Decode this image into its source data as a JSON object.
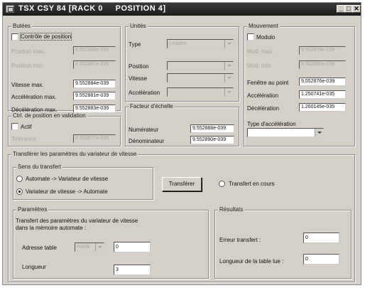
{
  "window": {
    "title": "TSX CSY 84 [RACK 0     POSITION 4]",
    "minimize": "_",
    "maximize": "□",
    "close": "✕"
  },
  "butees": {
    "title": "Butées",
    "controle_label": "Contrôle de position",
    "pos_max_label": "Position max.",
    "pos_max_value": "9.552888e-039",
    "pos_min_label": "Position min.",
    "pos_min_value": "9.552887e-039",
    "vitesse_label": "Vitesse max.",
    "vitesse_value": "9.552884e-039",
    "accel_label": "Accélération max.",
    "accel_value": "9.552881e-039",
    "decel_label": "Décélération max.",
    "decel_value": "9.552883e-039"
  },
  "ctrl_validation": {
    "title": "Ctrl. de position en validation",
    "actif_label": "Actif",
    "tolerance_label": "Tolérance",
    "tolerance_value": "9.552877e-039"
  },
  "unites": {
    "title": "Unités",
    "type_label": "Type",
    "type_value": "Linéaire",
    "position_label": "Position",
    "vitesse_label": "Vitesse",
    "acceleration_label": "Accélération"
  },
  "facteur": {
    "title": "Facteur d'échelle",
    "numerateur_label": "Numérateur",
    "numerateur_value": "9.552888e-039",
    "denominateur_label": "Dénominateur",
    "denominateur_value": "9.552890e-039"
  },
  "mouvement": {
    "title": "Mouvement",
    "modulo_label": "Modulo",
    "mod_max_label": "Mod. max.",
    "mod_max_value": "9.552879e-039",
    "mod_min_label": "Mod. min.",
    "mod_min_value": "9.552880e-039",
    "fenetre_label": "Fenêtre au point",
    "fenetre_value": "9.552876e-039",
    "acceleration_label": "Accélération",
    "acceleration_value": "1.250741e-035",
    "deceleration_label": "Décélération",
    "deceleration_value": "1.260145e-035",
    "type_accel_label": "Type d'accélération",
    "type_accel_value": ""
  },
  "transfert": {
    "title": "Transférer les paramètres du variateur de vitesse",
    "sens_title": "Sens du transfert",
    "option1": "Automate -> Variateur de vitesse",
    "option2": "Variateur de vitesse -> Automate",
    "button": "Transférer",
    "en_cours": "Transfert en cours"
  },
  "parametres": {
    "title": "Paramètres",
    "description_line1": "Transfert des paramètres du variateur de vitesse",
    "description_line2": "dans la mémoire automate :",
    "adresse_label": "Adresse table",
    "adresse_type": "%MW",
    "adresse_value": "0",
    "longueur_label": "Longueur",
    "longueur_value": "3"
  },
  "resultats": {
    "title": "Résultats",
    "erreur_label": "Erreur transfert :",
    "erreur_value": "0",
    "longueur_lue_label": "Longueur de la table lue :",
    "longueur_lue_value": "0"
  }
}
